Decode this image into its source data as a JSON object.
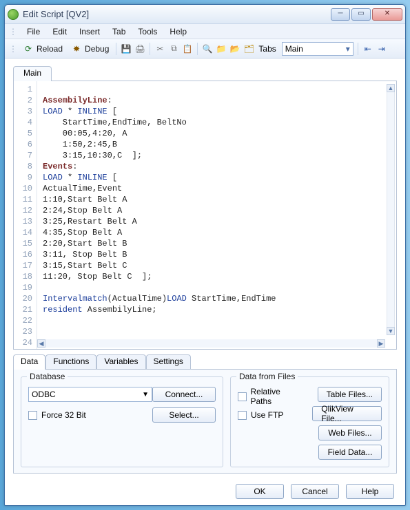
{
  "window": {
    "title": "Edit Script [QV2]"
  },
  "menu": {
    "file": "File",
    "edit": "Edit",
    "insert": "Insert",
    "tab": "Tab",
    "tools": "Tools",
    "help": "Help"
  },
  "toolbar": {
    "reload": "Reload",
    "debug": "Debug",
    "tabs_label": "Tabs",
    "tabs_selected": "Main"
  },
  "editor": {
    "tab_main": "Main",
    "line_numbers": [
      "1",
      "2",
      "3",
      "4",
      "5",
      "6",
      "7",
      "8",
      "9",
      "10",
      "11",
      "12",
      "13",
      "14",
      "15",
      "16",
      "17",
      "18",
      "19",
      "20",
      "21",
      "22",
      "23",
      "24"
    ],
    "lines": {
      "l1": "",
      "lbl_assembly": "AssembilyLine",
      "kw_load": "LOAD",
      "kw_inline": "INLINE",
      "sym_star": " * ",
      "sym_open": " [",
      "l4": "    StartTime,EndTime, BeltNo",
      "l5": "    00:05,4:20, A",
      "l6": "    1:50,2:45,B",
      "l7": "    3:15,10:30,C  ];",
      "lbl_events": "Events",
      "l10": "ActualTime,Event",
      "l11": "1:10,Start Belt A",
      "l12": "2:24,Stop Belt A",
      "l13": "3:25,Restart Belt A",
      "l14": "4:35,Stop Belt A",
      "l15": "2:20,Start Belt B",
      "l16": "3:11, Stop Belt B",
      "l17": "3:15,Start Belt C",
      "l18": "11:20, Stop Belt C  ];",
      "l19": "",
      "fn_intervalmatch": "Intervalmatch",
      "arg_actualtime": "ActualTime",
      "l20_tail": " StartTime,EndTime",
      "kw_resident": "resident",
      "l21_tail": " AssembilyLine;",
      "colon": ":",
      "lp": "(",
      "rp": ")"
    }
  },
  "panel": {
    "tabs": {
      "data": "Data",
      "functions": "Functions",
      "variables": "Variables",
      "settings": "Settings"
    },
    "database_legend": "Database",
    "odbc": "ODBC",
    "connect": "Connect...",
    "force32": "Force 32 Bit",
    "select": "Select...",
    "files_legend": "Data from Files",
    "relative": "Relative Paths",
    "useftp": "Use FTP",
    "table_files": "Table Files...",
    "qlikview_file": "QlikView File...",
    "web_files": "Web Files...",
    "field_data": "Field Data..."
  },
  "dialog": {
    "ok": "OK",
    "cancel": "Cancel",
    "help": "Help"
  }
}
